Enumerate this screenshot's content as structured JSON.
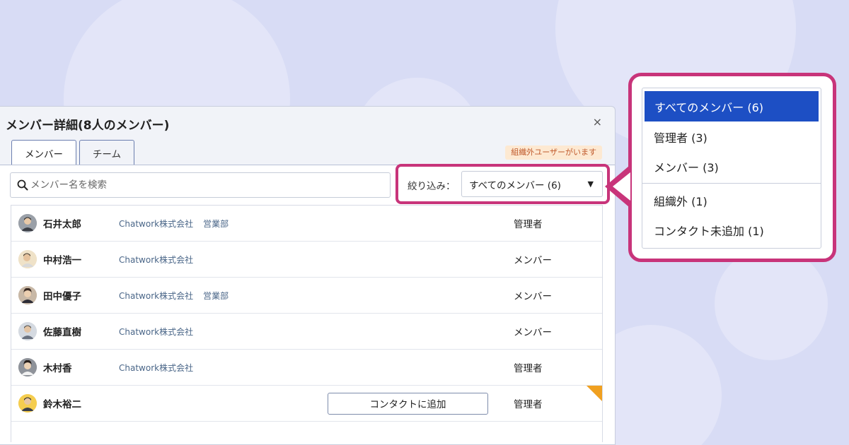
{
  "dialog": {
    "title": "メンバー詳細(8人のメンバー)",
    "close_symbol": "×",
    "tabs": [
      {
        "label": "メンバー",
        "active": true
      },
      {
        "label": "チーム",
        "active": false
      }
    ],
    "external_badge": "組織外ユーザーがいます",
    "search": {
      "placeholder": "メンバー名を検索",
      "value": ""
    },
    "filter": {
      "label": "絞り込み：",
      "selected": "すべてのメンバー (6)"
    }
  },
  "members": [
    {
      "name": "石井太郎",
      "org": "Chatwork株式会社",
      "dept": "営業部",
      "role": "管理者"
    },
    {
      "name": "中村浩一",
      "org": "Chatwork株式会社",
      "dept": "",
      "role": "メンバー"
    },
    {
      "name": "田中優子",
      "org": "Chatwork株式会社",
      "dept": "営業部",
      "role": "メンバー"
    },
    {
      "name": "佐藤直樹",
      "org": "Chatwork株式会社",
      "dept": "",
      "role": "メンバー"
    },
    {
      "name": "木村香",
      "org": "Chatwork株式会社",
      "dept": "",
      "role": "管理者"
    },
    {
      "name": "鈴木裕二",
      "org": "",
      "dept": "",
      "role": "管理者",
      "action": "コンタクトに追加"
    }
  ],
  "dropdown_options": [
    "すべてのメンバー (6)",
    "管理者 (3)",
    "メンバー (3)",
    "組織外 (1)",
    "コンタクト未追加 (1)"
  ],
  "colors": {
    "background": "#d8dcf5",
    "highlight": "#c8347a",
    "selected": "#1d4fc4",
    "badge_bg": "#fde9d2",
    "badge_text": "#c0592b",
    "external_corner": "#f0a020"
  }
}
